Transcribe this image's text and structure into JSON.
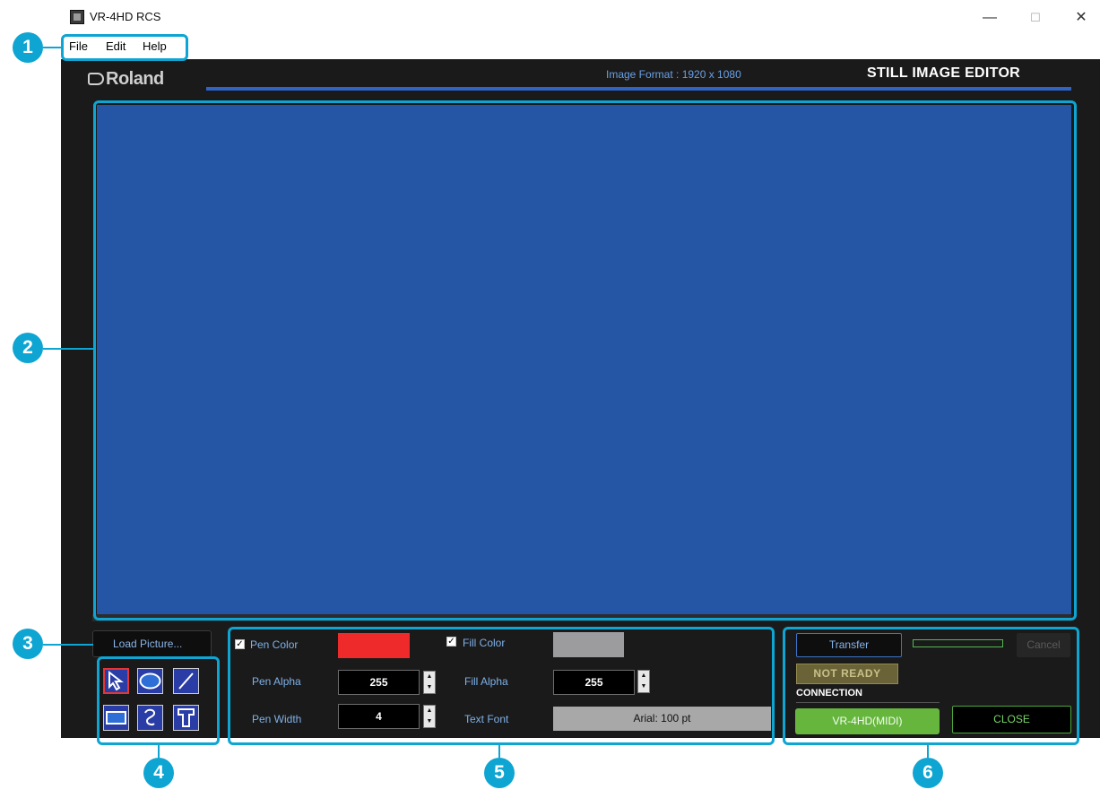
{
  "window": {
    "title": "VR-4HD RCS",
    "controls": {
      "minimize": "—",
      "maximize": "☐",
      "close": "✕"
    }
  },
  "menu": {
    "items": [
      "File",
      "Edit",
      "Help"
    ]
  },
  "header": {
    "logo": "Roland",
    "image_format": "Image Format : 1920 x 1080",
    "editor_title": "STILL IMAGE EDITOR"
  },
  "canvas": {
    "color": "#2556a5"
  },
  "load_button": {
    "label": "Load Picture..."
  },
  "tools": [
    "select-arrow-icon",
    "ellipse-icon",
    "line-icon",
    "rectangle-icon",
    "freehand-icon",
    "text-icon"
  ],
  "properties": {
    "pen_color": {
      "label": "Pen Color",
      "checked": true,
      "value": "#ee2a2a"
    },
    "fill_color": {
      "label": "Fill Color",
      "checked": true,
      "value": "#9c9c9e"
    },
    "pen_alpha": {
      "label": "Pen Alpha",
      "value": "255"
    },
    "fill_alpha": {
      "label": "Fill Alpha",
      "value": "255"
    },
    "pen_width": {
      "label": "Pen Width",
      "value": "4"
    },
    "text_font": {
      "label": "Text Font",
      "value": "Arial: 100 pt"
    }
  },
  "transfer": {
    "transfer_label": "Transfer",
    "cancel_label": "Cancel",
    "status": "NOT READY",
    "connection_label": "CONNECTION",
    "device_label": "VR-4HD(MIDI)",
    "close_label": "CLOSE"
  },
  "callouts": [
    "1",
    "2",
    "3",
    "4",
    "5",
    "6"
  ]
}
